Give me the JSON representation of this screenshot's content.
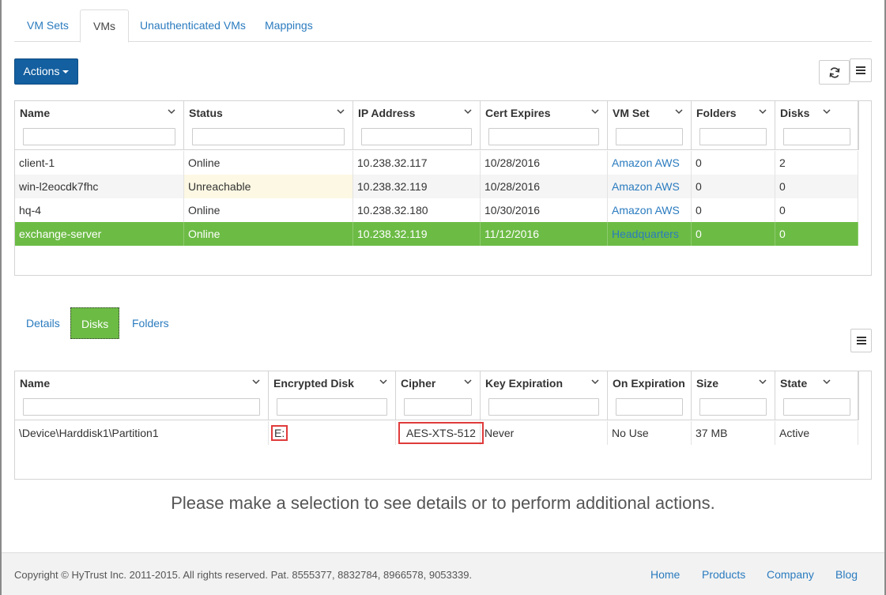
{
  "top_tabs": [
    {
      "label": "VM Sets"
    },
    {
      "label": "VMs"
    },
    {
      "label": "Unauthenticated VMs"
    },
    {
      "label": "Mappings"
    }
  ],
  "toolbar": {
    "actions_label": "Actions",
    "refresh_icon": "refresh-icon",
    "columns_menu_icon": "menu-icon"
  },
  "vm_grid": {
    "columns": [
      "Name",
      "Status",
      "IP Address",
      "Cert Expires",
      "VM Set",
      "Folders",
      "Disks"
    ],
    "rows": [
      {
        "name": "client-1",
        "status": "Online",
        "ip": "10.238.32.117",
        "cert": "10/28/2016",
        "vmset": "Amazon AWS",
        "folders": "0",
        "disks": "2"
      },
      {
        "name": "win-l2eocdk7fhc",
        "status": "Unreachable",
        "ip": "10.238.32.119",
        "cert": "10/28/2016",
        "vmset": "Amazon AWS",
        "folders": "0",
        "disks": "0"
      },
      {
        "name": "hq-4",
        "status": "Online",
        "ip": "10.238.32.180",
        "cert": "10/30/2016",
        "vmset": "Amazon AWS",
        "folders": "0",
        "disks": "0"
      },
      {
        "name": "exchange-server",
        "status": "Online",
        "ip": "10.238.32.119",
        "cert": "11/12/2016",
        "vmset": "Headquarters",
        "folders": "0",
        "disks": "0"
      }
    ],
    "selected_row": 3
  },
  "detail_tabs": [
    {
      "label": "Details"
    },
    {
      "label": "Disks"
    },
    {
      "label": "Folders"
    }
  ],
  "disk_grid": {
    "columns": [
      "Name",
      "Encrypted Disk",
      "Cipher",
      "Key Expiration",
      "On Expiration",
      "Size",
      "State"
    ],
    "rows": [
      {
        "name": "\\Device\\Harddisk1\\Partition1",
        "encrypted": "E:",
        "cipher": "AES-XTS-512",
        "key_exp": "Never",
        "on_exp": "No Use",
        "size": "37 MB",
        "state": "Active"
      }
    ]
  },
  "message": "Please make a selection to see details or to perform additional actions.",
  "footer": {
    "copyright": "Copyright © HyTrust Inc. 2011-2015. All rights reserved. Pat. 8555377, 8832784, 8966578, 9053339.",
    "links": [
      "Home",
      "Products",
      "Company",
      "Blog"
    ]
  },
  "colors": {
    "primary": "#135fa0",
    "selected_row": "#6cbb45",
    "link": "#2a7bbf",
    "warning_cell": "#fcf8e3",
    "highlight_outline": "#e03b3b"
  }
}
